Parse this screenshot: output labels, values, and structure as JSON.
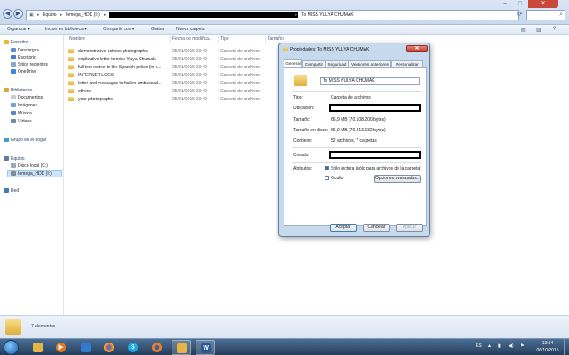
{
  "address": {
    "segments": [
      "Equipo",
      "Iomega_HDD (I:)"
    ],
    "current_folder": "To MISS YULYA CHUMAK"
  },
  "toolbar": {
    "organize": "Organizar ▾",
    "include": "Incluir en biblioteca ▾",
    "share": "Compartir con ▾",
    "burn": "Grabar",
    "new_folder": "Nueva carpeta"
  },
  "nav": {
    "favorites": "Favoritos",
    "downloads": "Descargas",
    "desktop": "Escritorio",
    "recent": "Sitios recientes",
    "onedrive": "OneDrive",
    "libraries": "Bibliotecas",
    "documents": "Documentos",
    "images": "Imágenes",
    "music": "Música",
    "videos": "Vídeos",
    "homegroup": "Grupo en el hogar",
    "computer": "Equipo",
    "local_disk": "Disco local (C:)",
    "iomega": "Iomega_HDD (I:)",
    "network": "Red"
  },
  "columns": {
    "name": "Nombre",
    "date": "Fecha de modifica...",
    "type": "Tipo",
    "size": "Tamaño"
  },
  "files": [
    {
      "name": "demonstrative actions photographs",
      "date": "25/01/2015 23:49",
      "type": "Carpeta de archivos"
    },
    {
      "name": "explicative letter to miss Yulya Chumak",
      "date": "25/01/2015 23:49",
      "type": "Carpeta de archivos"
    },
    {
      "name": "full text notice to the Spanish police (in c...",
      "date": "25/01/2015 23:49",
      "type": "Carpeta de archivos"
    },
    {
      "name": "INTERNET LOGS",
      "date": "25/01/2015 23:49",
      "type": "Carpeta de archivos"
    },
    {
      "name": "letter and messages to Italien ambassad...",
      "date": "25/01/2015 23:49",
      "type": "Carpeta de archivos"
    },
    {
      "name": "others",
      "date": "25/01/2015 23:49",
      "type": "Carpeta de archivos"
    },
    {
      "name": "your photographs",
      "date": "25/01/2015 23:49",
      "type": "Carpeta de archivos"
    }
  ],
  "status": {
    "count": "7 elementos"
  },
  "dialog": {
    "title": "Propiedades: To MISS YULYA CHUMAK",
    "tabs": [
      "General",
      "Compartir",
      "Seguridad",
      "Versiones anteriores",
      "Personalizar"
    ],
    "folder_name": "To MISS YULYA CHUMAK",
    "type_label": "Tipo:",
    "type_value": "Carpeta de archivos",
    "location_label": "Ubicación:",
    "size_label": "Tamaño:",
    "size_value": "66,9 MB (70.108.200 bytes)",
    "disk_size_label": "Tamaño en disco:",
    "disk_size_value": "66,9 MB (70.213.632 bytes)",
    "contains_label": "Contiene:",
    "contains_value": "52 archivos, 7 carpetas",
    "created_label": "Creado:",
    "attributes_label": "Atributos:",
    "readonly": "Sólo lectura (sólo para archivos de la carpeta)",
    "hidden": "Oculto",
    "advanced": "Opciones avanzadas...",
    "ok": "Aceptar",
    "cancel": "Cancelar",
    "apply": "Aplicar"
  },
  "taskbar": {
    "language": "ES",
    "time": "13:34",
    "date": "06/10/2015"
  },
  "colors": {
    "taskbar": "#253d5a",
    "dialog_frame": "#c7d9ed",
    "folder": "#e2b340"
  }
}
